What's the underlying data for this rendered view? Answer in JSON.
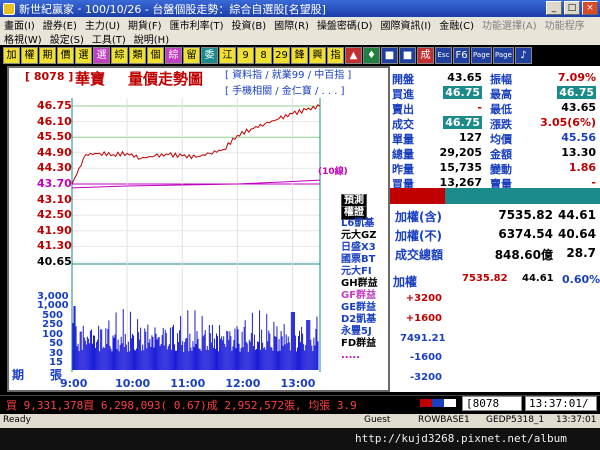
{
  "window": {
    "app_name": "新世紀贏家",
    "title": "100/10/26 - 台盤個股走勢：綜合自選股[名望股]"
  },
  "menu": {
    "row1": [
      "畫面(I)",
      "證券(E)",
      "主力(U)",
      "期貨(F)",
      "匯市利率(T)",
      "投資(B)",
      "國際(R)",
      "操盤密碼(D)",
      "國際資訊(I)",
      "金融(C)",
      "功能選擇(A)",
      "功能程序"
    ],
    "row2": [
      "格視(W)",
      "設定(S)",
      "工具(T)",
      "說明(H)"
    ]
  },
  "toolbar": {
    "buttons": [
      {
        "label": "加",
        "style": "y"
      },
      {
        "label": "權",
        "style": "y"
      },
      {
        "label": "期",
        "style": "y"
      },
      {
        "label": "價",
        "style": "y"
      },
      {
        "label": "選",
        "style": "y"
      },
      {
        "label": "選",
        "style": "m"
      },
      {
        "label": "綜",
        "style": "y"
      },
      {
        "label": "類",
        "style": "y"
      },
      {
        "label": "個",
        "style": "y"
      },
      {
        "label": "綜",
        "style": "m"
      },
      {
        "label": "留",
        "style": "y"
      },
      {
        "label": "委",
        "style": "c"
      },
      {
        "label": "江",
        "style": "y"
      },
      {
        "label": "9",
        "style": "y"
      },
      {
        "label": "8",
        "style": "y"
      },
      {
        "label": "29",
        "style": "y"
      },
      {
        "label": "鋒",
        "style": "y"
      },
      {
        "label": "興",
        "style": "y"
      },
      {
        "label": "指",
        "style": "y"
      },
      {
        "label": "▲",
        "style": "r"
      },
      {
        "label": "♦",
        "style": "g"
      },
      {
        "label": "■",
        "style": "b"
      },
      {
        "label": "■",
        "style": "b"
      },
      {
        "label": "成",
        "style": "r"
      },
      {
        "label": "Esc",
        "style": "b"
      },
      {
        "label": "F6",
        "style": "b"
      },
      {
        "label": "Page",
        "style": "b"
      },
      {
        "label": "Page",
        "style": "b"
      },
      {
        "label": "♪",
        "style": "b"
      }
    ]
  },
  "chart_header": {
    "code": "[ 8078 ]",
    "name": "華寶",
    "title": "量價走勢圖",
    "info_line1": "[ 資料指 / 就業99 / 中百指 ]",
    "info_line2": "[ 手機相關 / 金仁寶 / . . . ]",
    "avg_label": "(10線)"
  },
  "price_axis": {
    "labels": [
      "46.75",
      "46.10",
      "45.50",
      "44.90",
      "44.30",
      "43.70",
      "43.10",
      "42.50",
      "41.90",
      "41.30",
      "40.65"
    ],
    "open_price_label": "43.70",
    "limit_up": "46.75",
    "limit_down": "40.65"
  },
  "volume_axis": {
    "labels": [
      "3,000",
      "1,000",
      "500",
      "250",
      "100",
      "50",
      "30",
      "15"
    ],
    "unit_left": "期",
    "unit_right": "張"
  },
  "time_axis": {
    "labels": [
      "9:00",
      "10:00",
      "11:00",
      "12:00",
      "13:00"
    ]
  },
  "legend": {
    "items": [
      "預測",
      "權證",
      "L6凱基",
      "元大GZ",
      "日盛X3",
      "國票BT",
      "元大FI",
      "GH群益",
      "GF群益",
      "GE群益",
      "D2凱基",
      "永豐5J",
      "FD群益",
      "....."
    ]
  },
  "quote": {
    "rows": [
      {
        "l1": "開盤",
        "v1": "43.65",
        "l2": "振幅",
        "v2": "7.09%",
        "v2color": "#c00000"
      },
      {
        "l1": "買進",
        "v1": "46.75",
        "v1hi": true,
        "l2": "最高",
        "v2": "46.75",
        "v2hi": true
      },
      {
        "l1": "賣出",
        "v1": "-",
        "v1color": "#c00000",
        "l2": "最低",
        "v2": "43.65"
      },
      {
        "l1": "成交",
        "v1": "46.75",
        "v1hi": true,
        "l2": "漲跌",
        "v2": "3.05(6%)",
        "v2color": "#c00000"
      },
      {
        "l1": "單量",
        "v1": "127",
        "l2": "均價",
        "v2": "45.56",
        "v2color": "#1a40c0"
      },
      {
        "l1": "總量",
        "v1": "29,205",
        "l2": "金額",
        "v2": "13.30"
      },
      {
        "l1": "昨量",
        "v1": "15,735",
        "l2": "變動",
        "v2": "1.86",
        "v2color": "#c00000"
      },
      {
        "l1": "買量",
        "v1": "13,267",
        "l2": "賣量",
        "v2": "-",
        "v2color": "#c00000"
      }
    ]
  },
  "index_summary": {
    "rows": [
      {
        "label": "加權(含)",
        "value": "7535.82",
        "change": "44.61"
      },
      {
        "label": "加權(不)",
        "value": "6374.54",
        "change": "40.64"
      },
      {
        "label": "成交總額",
        "value": "848.60億",
        "change": "28.7"
      }
    ]
  },
  "mini_chart": {
    "label": "加權",
    "value": "7535.82",
    "change": "44.61",
    "pct": "0.60%",
    "y_labels": [
      "+3200",
      "+1600",
      "7491.21",
      "-1600",
      "-3200"
    ]
  },
  "status_bar": {
    "text": "買 9,331,378買 6,298,093( 0.67)成 2,952,572張, 均張 3.9",
    "code": "8078",
    "clock": "13:37:01/"
  },
  "win_status": {
    "ready": "Ready",
    "user": "Guest",
    "server": "ROWBASE1",
    "ver": "GEDP5318_1",
    "time": "13:37:01"
  },
  "watermark": "http://kujd3268.pixnet.net/album",
  "chart_data": [
    {
      "type": "line",
      "title": "量價走勢圖",
      "xlabel": "",
      "ylabel": "",
      "x_range": [
        "9:00",
        "13:30"
      ],
      "ylim": [
        40.65,
        46.75
      ],
      "series": [
        {
          "x": [
            "9:00",
            "9:15",
            "9:30",
            "9:45",
            "10:00",
            "10:15",
            "10:30",
            "10:45",
            "11:00",
            "11:15",
            "11:30",
            "11:45",
            "12:00",
            "12:15",
            "12:30",
            "12:45",
            "13:00",
            "13:15",
            "13:30"
          ],
          "values": [
            43.7,
            44.85,
            44.9,
            44.85,
            44.9,
            44.7,
            44.8,
            44.85,
            44.8,
            44.75,
            44.9,
            45.05,
            45.6,
            45.85,
            46.05,
            46.25,
            46.45,
            46.6,
            46.75
          ],
          "color": "#c00000"
        },
        {
          "x": [
            "9:00",
            "10:00",
            "11:00",
            "12:00",
            "13:00",
            "13:30"
          ],
          "values": [
            43.55,
            43.62,
            43.66,
            43.7,
            43.8,
            43.85
          ],
          "color": "#c000c0"
        }
      ]
    },
    {
      "type": "bar",
      "title": "",
      "xlabel": "",
      "ylabel": "",
      "x_range": [
        "9:00",
        "13:30"
      ],
      "y_labels": [
        "3,000",
        "1,000",
        "500",
        "250",
        "100",
        "50",
        "30",
        "15"
      ],
      "color": "#1a1ad8"
    },
    {
      "type": "line",
      "title": "加權",
      "ylim": [
        -3200,
        3200
      ],
      "series": [
        {
          "values": [
            0,
            -900,
            -1500,
            -1900,
            -2000,
            -1600,
            -1300,
            -1000,
            -1200,
            -900,
            -700,
            -500,
            -600,
            -400,
            0,
            200,
            500,
            900,
            1400,
            1800,
            2100,
            1600
          ],
          "color": "#1a1ad8"
        },
        {
          "values": [
            0,
            1000,
            1500,
            1800,
            2000,
            2300,
            2200,
            2000,
            1900,
            2100,
            2300,
            2500,
            2700,
            2800,
            3000,
            2900,
            3100,
            3000,
            2800,
            2600,
            2900,
            3100
          ],
          "color": "#e060c0"
        }
      ]
    }
  ]
}
